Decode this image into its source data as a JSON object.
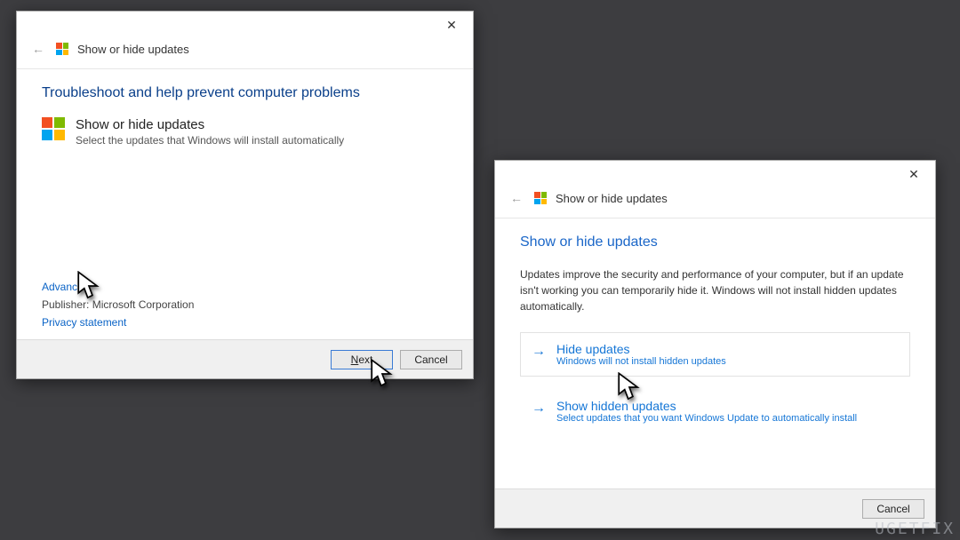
{
  "watermark": "UGETFIX",
  "window1": {
    "header_title": "Show or hide updates",
    "page_title": "Troubleshoot and help prevent computer problems",
    "intro_title": "Show or hide updates",
    "intro_sub": "Select the updates that Windows will install automatically",
    "advanced_link": "Advanced",
    "publisher_label": "Publisher: Microsoft Corporation",
    "privacy_link": "Privacy statement",
    "next_prefix": "N",
    "next_suffix": "ext",
    "cancel_label": "Cancel"
  },
  "window2": {
    "header_title": "Show or hide updates",
    "page_title": "Show or hide updates",
    "description": "Updates improve the security and performance of your computer, but if an update isn't working you can temporarily hide it. Windows will not install hidden updates automatically.",
    "opt1_title": "Hide updates",
    "opt1_sub": "Windows will not install hidden updates",
    "opt2_title": "Show hidden updates",
    "opt2_sub": "Select updates that you want Windows Update to automatically install",
    "cancel_label": "Cancel"
  }
}
